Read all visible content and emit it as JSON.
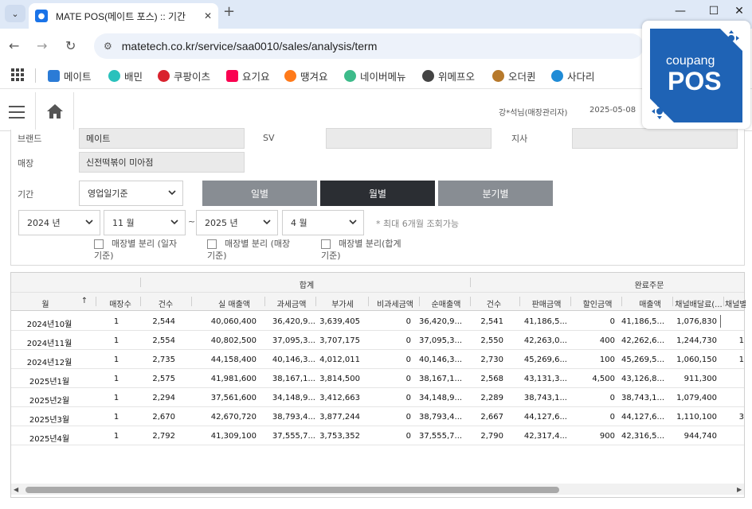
{
  "browser": {
    "tab_title": "MATE POS(메이트 포스) :: 기간",
    "url": "matetech.co.kr/service/saa0010/sales/analysis/term",
    "bookmarks": [
      {
        "label": "메이트",
        "color": "#2b7bd6"
      },
      {
        "label": "배민",
        "color": "#2ac1bc"
      },
      {
        "label": "쿠팡이츠",
        "color": "#d9232e"
      },
      {
        "label": "요기요",
        "color": "#fa0050"
      },
      {
        "label": "땡겨요",
        "color": "#ff7a1a"
      },
      {
        "label": "네이버메뉴",
        "color": "#3dbb8a"
      },
      {
        "label": "위메프오",
        "color": "#444444"
      },
      {
        "label": "오더퀸",
        "color": "#b7792b"
      },
      {
        "label": "사다리",
        "color": "#1f8bd6"
      }
    ]
  },
  "header": {
    "user": "강*석님(매장관리자)",
    "date": "2025-05-08"
  },
  "badge": {
    "brand": "coupang",
    "product": "POS"
  },
  "filters": {
    "brand_label": "브랜드",
    "brand_value": "메이트",
    "sv_label": "SV",
    "sv_value": "",
    "branch_label": "지사",
    "branch_value": "",
    "store_label": "매장",
    "store_value": "신전떡볶이 미아점",
    "period_label": "기간",
    "period_basis": "영업일기준",
    "period_buttons": [
      "일별",
      "월별",
      "분기별"
    ],
    "active_period": "월별",
    "start_year": "2024 년",
    "start_month": "11 월",
    "end_year": "2025 년",
    "end_month": "4 월",
    "tilde": "~",
    "max_note": "* 최대 6개월 조회가능",
    "checkboxes": [
      {
        "label": "매장별 분리 (일자기준)",
        "checked": false
      },
      {
        "label": "매장별 분리 (매장기준)",
        "checked": false
      },
      {
        "label": "매장별 분리(합계기준)",
        "checked": false
      }
    ]
  },
  "grid": {
    "group_total": "합계",
    "group_completed": "완료주문",
    "columns": [
      "월",
      "매장수",
      "건수",
      "실 매출액",
      "과세금액",
      "부가세",
      "비과세금액",
      "순매출액",
      "건수",
      "판매금액",
      "할인금액",
      "매출액",
      "채널배달료(...",
      "채널별"
    ],
    "rows": [
      [
        "2024년10월",
        "1",
        "2,544",
        "40,060,400",
        "36,420,9...",
        "3,639,405",
        "0",
        "36,420,9...",
        "2,541",
        "41,186,5...",
        "0",
        "41,186,5...",
        "1,076,830",
        ""
      ],
      [
        "2024년11월",
        "1",
        "2,554",
        "40,802,500",
        "37,095,3...",
        "3,707,175",
        "0",
        "37,095,3...",
        "2,550",
        "42,263,0...",
        "400",
        "42,262,6...",
        "1,244,730",
        "1"
      ],
      [
        "2024년12월",
        "1",
        "2,735",
        "44,158,400",
        "40,146,3...",
        "4,012,011",
        "0",
        "40,146,3...",
        "2,730",
        "45,269,6...",
        "100",
        "45,269,5...",
        "1,060,150",
        "1"
      ],
      [
        "2025년1월",
        "1",
        "2,575",
        "41,981,600",
        "38,167,1...",
        "3,814,500",
        "0",
        "38,167,1...",
        "2,568",
        "43,131,3...",
        "4,500",
        "43,126,8...",
        "911,300",
        ""
      ],
      [
        "2025년2월",
        "1",
        "2,294",
        "37,561,600",
        "34,148,9...",
        "3,412,663",
        "0",
        "34,148,9...",
        "2,289",
        "38,743,1...",
        "0",
        "38,743,1...",
        "1,079,400",
        ""
      ],
      [
        "2025년3월",
        "1",
        "2,670",
        "42,670,720",
        "38,793,4...",
        "3,877,244",
        "0",
        "38,793,4...",
        "2,667",
        "44,127,6...",
        "0",
        "44,127,6...",
        "1,110,100",
        "3"
      ],
      [
        "2025년4월",
        "1",
        "2,792",
        "41,309,100",
        "37,555,7...",
        "3,753,352",
        "0",
        "37,555,7...",
        "2,790",
        "42,317,4...",
        "900",
        "42,316,5...",
        "944,740",
        ""
      ]
    ]
  }
}
